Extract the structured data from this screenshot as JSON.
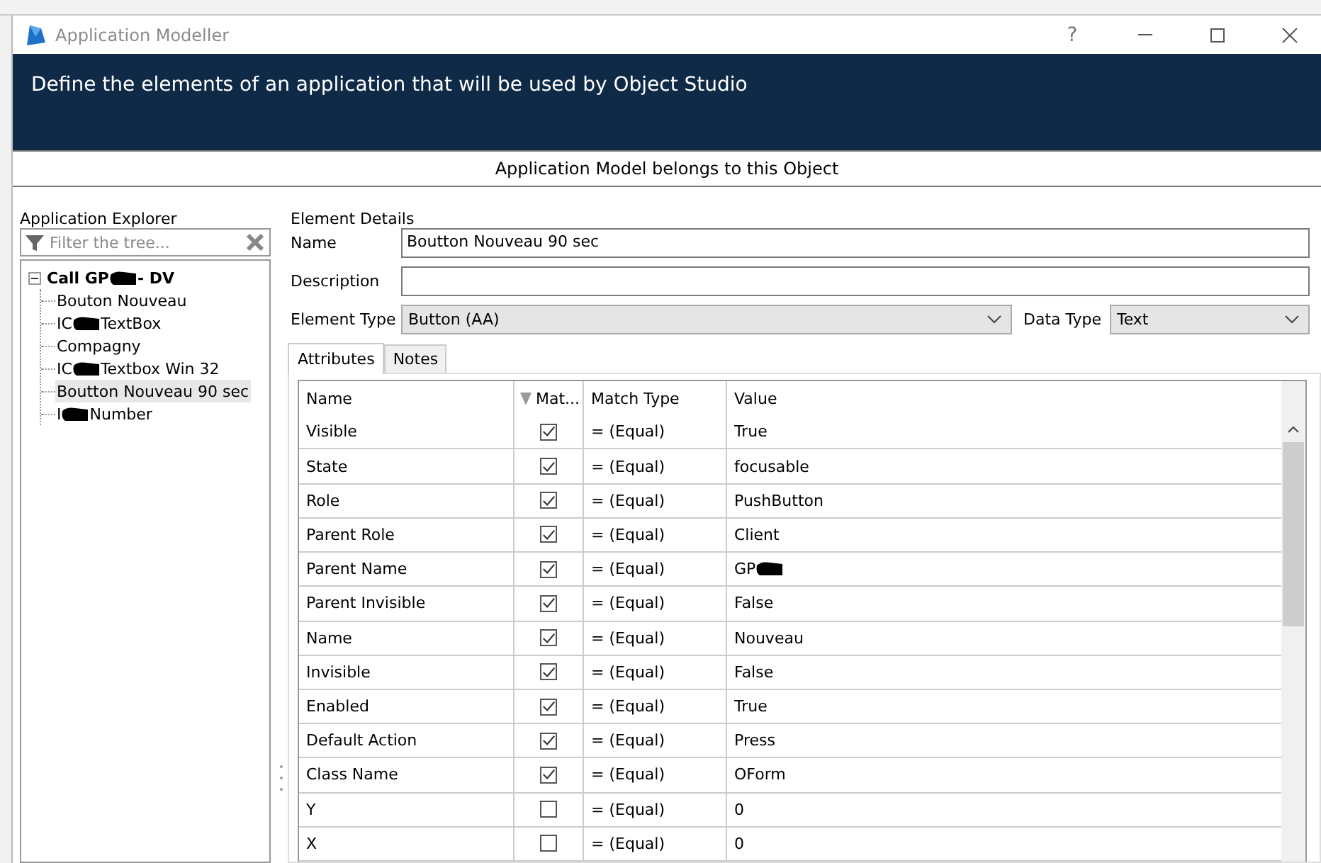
{
  "window": {
    "title": "Application Modeller",
    "help": "?"
  },
  "banner": {
    "text": "Define the elements of an application that will be used by Object Studio"
  },
  "object_bar": {
    "text": "Application Model belongs to this Object"
  },
  "explorer": {
    "title": "Application Explorer",
    "filter": {
      "placeholder": "Filter the tree..."
    },
    "tree": [
      {
        "start": "Call GP",
        "redacted": true,
        "end": "- DV",
        "expanded": true,
        "selected": false,
        "children": [
          {
            "start": "Bouton Nouveau",
            "redacted": false,
            "selected": false
          },
          {
            "start": "IC",
            "redacted": true,
            "end": "TextBox",
            "selected": false
          },
          {
            "start": "Compagny",
            "redacted": false,
            "selected": false
          },
          {
            "start": "IC",
            "redacted": true,
            "end": "Textbox Win 32",
            "selected": false
          },
          {
            "start": "Boutton Nouveau 90 sec",
            "redacted": false,
            "selected": true
          },
          {
            "start": "I",
            "redacted": true,
            "end": "Number",
            "selected": false
          }
        ]
      }
    ]
  },
  "details": {
    "title": "Element Details",
    "name_label": "Name",
    "name_value": "Boutton Nouveau 90 sec",
    "description_label": "Description",
    "element_type_label": "Element Type",
    "element_type_value": "Button (AA)",
    "data_type_label": "Data Type",
    "data_type_value": "Text"
  },
  "tabs": [
    {
      "label": "Attributes",
      "selected": true
    },
    {
      "label": "Notes",
      "selected": false
    }
  ],
  "table": {
    "columns": [
      "Name",
      "Mat...",
      "Match Type",
      "Value"
    ],
    "rows": [
      {
        "name": "Visible",
        "checked": true,
        "match_type": "=  (Equal)",
        "value": "True",
        "redacted": false
      },
      {
        "name": "State",
        "checked": true,
        "match_type": "=  (Equal)",
        "value": "focusable",
        "redacted": false
      },
      {
        "name": "Role",
        "checked": true,
        "match_type": "=  (Equal)",
        "value": "PushButton",
        "redacted": false
      },
      {
        "name": "Parent Role",
        "checked": true,
        "match_type": "=  (Equal)",
        "value": "Client",
        "redacted": false
      },
      {
        "name": "Parent Name",
        "checked": true,
        "match_type": "=  (Equal)",
        "value": "GP",
        "redacted": true
      },
      {
        "name": "Parent Invisible",
        "checked": true,
        "match_type": "=  (Equal)",
        "value": "False",
        "redacted": false
      },
      {
        "name": "Name",
        "checked": true,
        "match_type": "=  (Equal)",
        "value": "Nouveau",
        "redacted": false
      },
      {
        "name": "Invisible",
        "checked": true,
        "match_type": "=  (Equal)",
        "value": "False",
        "redacted": false
      },
      {
        "name": "Enabled",
        "checked": true,
        "match_type": "=  (Equal)",
        "value": "True",
        "redacted": false
      },
      {
        "name": "Default Action",
        "checked": true,
        "match_type": "=  (Equal)",
        "value": "Press",
        "redacted": false
      },
      {
        "name": "Class Name",
        "checked": true,
        "match_type": "=  (Equal)",
        "value": "OForm",
        "redacted": false
      },
      {
        "name": "Y",
        "checked": false,
        "match_type": "=  (Equal)",
        "value": "0",
        "redacted": false
      },
      {
        "name": "X",
        "checked": false,
        "match_type": "=  (Equal)",
        "value": "0",
        "redacted": false
      }
    ]
  }
}
